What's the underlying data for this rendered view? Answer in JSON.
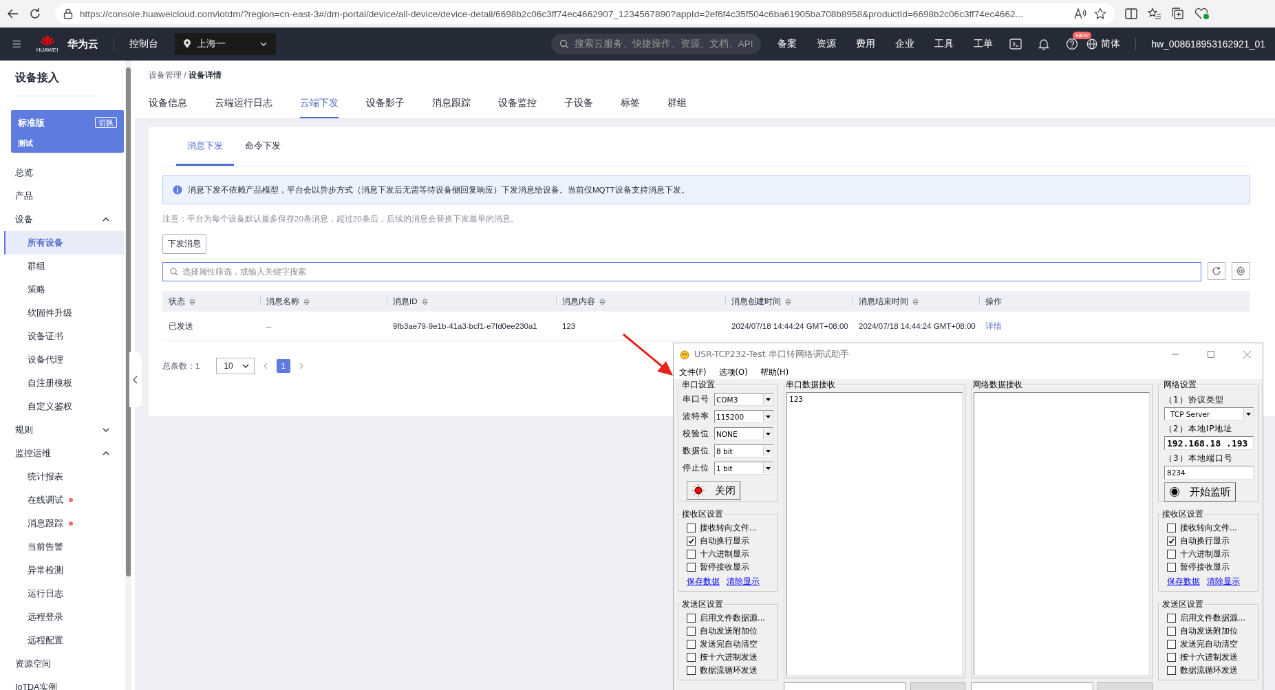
{
  "browser": {
    "url": "https://console.huaweicloud.com/iotdm/?region=cn-east-3#/dm-portal/device/all-device/device-detail/6698b2c06c3ff74ec4662907_1234567890?appId=2ef6f4c35f504c6ba61905ba708b8958&productId=6698b2c06c3ff74ec4662..."
  },
  "header": {
    "logo_text": "HUAWEI",
    "brand": "华为云",
    "console": "控制台",
    "region": "上海一",
    "search_placeholder": "搜索云服务、快捷操作、资源、文档、API",
    "nav": [
      "备案",
      "资源",
      "费用",
      "企业",
      "工具",
      "工单"
    ],
    "new_badge": "NEW",
    "language": "简体",
    "user": "hw_008618953162921_01"
  },
  "sidebar": {
    "title": "设备接入",
    "edition": {
      "name": "标准版",
      "switch": "切换",
      "instance": "测试"
    },
    "items": [
      {
        "label": "总览",
        "selected": false
      },
      {
        "label": "产品",
        "selected": false
      },
      {
        "label": "设备",
        "selected": false,
        "expanded": true,
        "children": [
          {
            "label": "所有设备",
            "selected": true,
            "dot": false
          },
          {
            "label": "群组",
            "selected": false,
            "dot": false
          },
          {
            "label": "策略",
            "selected": false,
            "dot": false
          },
          {
            "label": "软固件升级",
            "selected": false,
            "dot": false
          },
          {
            "label": "设备证书",
            "selected": false,
            "dot": false
          },
          {
            "label": "设备代理",
            "selected": false,
            "dot": false
          },
          {
            "label": "自注册模板",
            "selected": false,
            "dot": false
          },
          {
            "label": "自定义鉴权",
            "selected": false,
            "dot": false
          }
        ]
      },
      {
        "label": "规则",
        "selected": false,
        "expanded": false
      },
      {
        "label": "监控运维",
        "selected": false,
        "expanded": true,
        "children": [
          {
            "label": "统计报表",
            "selected": false,
            "dot": false
          },
          {
            "label": "在线调试",
            "selected": false,
            "dot": true
          },
          {
            "label": "消息跟踪",
            "selected": false,
            "dot": true
          },
          {
            "label": "当前告警",
            "selected": false,
            "dot": false
          },
          {
            "label": "异常检测",
            "selected": false,
            "dot": false
          },
          {
            "label": "运行日志",
            "selected": false,
            "dot": false
          },
          {
            "label": "远程登录",
            "selected": false,
            "dot": false
          },
          {
            "label": "远程配置",
            "selected": false,
            "dot": false
          }
        ]
      },
      {
        "label": "资源空间",
        "selected": false
      },
      {
        "label": "IoTDA实例",
        "selected": false
      }
    ]
  },
  "main": {
    "breadcrumb": [
      "设备管理",
      "设备详情"
    ],
    "breadcrumb_separator": "/",
    "tabs": [
      {
        "label": "设备信息",
        "selected": false
      },
      {
        "label": "云端运行日志",
        "selected": false
      },
      {
        "label": "云端下发",
        "selected": true
      },
      {
        "label": "设备影子",
        "selected": false
      },
      {
        "label": "消息跟踪",
        "selected": false
      },
      {
        "label": "设备监控",
        "selected": false
      },
      {
        "label": "子设备",
        "selected": false
      },
      {
        "label": "标签",
        "selected": false
      },
      {
        "label": "群组",
        "selected": false
      }
    ],
    "subtabs": [
      {
        "label": "消息下发",
        "selected": true
      },
      {
        "label": "命令下发",
        "selected": false
      }
    ],
    "notice": "消息下发不依赖产品模型，平台会以异步方式（消息下发后无需等待设备侧回复响应）下发消息给设备。当前仅MQTT设备支持消息下发。",
    "note": "注意：平台为每个设备默认最多保存20条消息，超过20条后，后续的消息会替换下发最早的消息。",
    "send_button": "下发消息",
    "search_placeholder": "选择属性筛选，或输入关键字搜索",
    "table": {
      "columns": [
        {
          "label": "状态",
          "sortable": true
        },
        {
          "label": "消息名称",
          "sortable": true
        },
        {
          "label": "消息ID",
          "sortable": true
        },
        {
          "label": "消息内容",
          "sortable": true
        },
        {
          "label": "消息创建时间",
          "sortable": true
        },
        {
          "label": "消息结束时间",
          "sortable": true
        },
        {
          "label": "操作",
          "sortable": false
        }
      ],
      "rows": [
        {
          "cells": [
            "已发送",
            "--",
            "9fb3ae79-9e1b-41a3-bcf1-e7fd0ee230a1",
            "123",
            "2024/07/18 14:44:24 GMT+08:00",
            "2024/07/18 14:44:24 GMT+08:00"
          ],
          "action": "详情"
        }
      ]
    },
    "pagination": {
      "total": "总条数：1",
      "page_size": "10",
      "pages": [
        {
          "label": "1",
          "selected": true
        }
      ]
    }
  },
  "dialog": {
    "title": "USR-TCP232-Test 串口转网络调试助手",
    "menu": [
      "文件(F)",
      "选项(O)",
      "帮助(H)"
    ],
    "serial_settings": {
      "title": "串口设置",
      "fields": [
        {
          "label": "串口号",
          "value": "COM3"
        },
        {
          "label": "波特率",
          "value": "115200"
        },
        {
          "label": "校验位",
          "value": "NONE"
        },
        {
          "label": "数据位",
          "value": "8 bit"
        },
        {
          "label": "停止位",
          "value": "1 bit"
        }
      ],
      "button": "关闭",
      "port_open": true
    },
    "serial_receive": {
      "title": "串口数据接收",
      "content": "123"
    },
    "network_receive": {
      "title": "网络数据接收"
    },
    "network_settings": {
      "title": "网络设置",
      "protocol_label": "（1）协议类型",
      "protocol": "TCP Server",
      "ip_label": "（2）本地IP地址",
      "ip": "192.168.18 .193",
      "port_label": "（3）本地端口号",
      "port": "8234",
      "button": "开始监听"
    },
    "left_receive": {
      "title": "接收区设置",
      "options": [
        {
          "label": "接收转向文件...",
          "checked": false
        },
        {
          "label": "自动换行显示",
          "checked": true
        },
        {
          "label": "十六进制显示",
          "checked": false
        },
        {
          "label": "暂停接收显示",
          "checked": false
        }
      ],
      "links": [
        "保存数据",
        "清除显示"
      ]
    },
    "left_send": {
      "title": "发送区设置",
      "options": [
        {
          "label": "启用文件数据源...",
          "checked": false
        },
        {
          "label": "自动发送附加位",
          "checked": false
        },
        {
          "label": "发送完自动清空",
          "checked": false
        },
        {
          "label": "按十六进制发送",
          "checked": false
        },
        {
          "label": "数据流循环发送",
          "checked": false
        }
      ]
    },
    "right_receive": {
      "title": "接收区设置",
      "options": [
        {
          "label": "接收转向文件...",
          "checked": false
        },
        {
          "label": "自动换行显示",
          "checked": true
        },
        {
          "label": "十六进制显示",
          "checked": false
        },
        {
          "label": "暂停接收显示",
          "checked": false
        }
      ],
      "links": [
        "保存数据",
        "清除显示"
      ]
    },
    "right_send": {
      "title": "发送区设置",
      "options": [
        {
          "label": "启用文件数据源...",
          "checked": false
        },
        {
          "label": "自动发送附加位",
          "checked": false
        },
        {
          "label": "发送完自动清空",
          "checked": false
        },
        {
          "label": "按十六进制发送",
          "checked": false
        },
        {
          "label": "数据流循环发送",
          "checked": false
        }
      ]
    }
  }
}
